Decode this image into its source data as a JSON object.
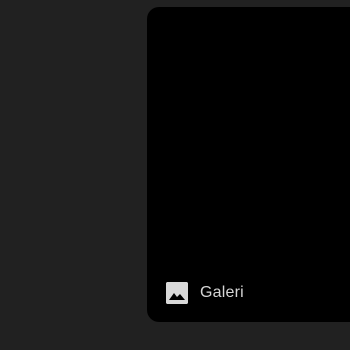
{
  "colors": {
    "background": "#212121",
    "card": "#000000",
    "icon": "#d9d9d9",
    "label": "#d6d6d6"
  },
  "gallery": {
    "icon": "image-icon",
    "label": "Galeri"
  }
}
